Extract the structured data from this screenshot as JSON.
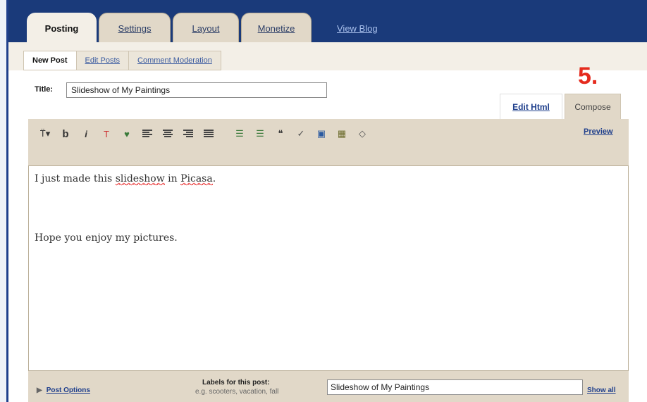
{
  "nav": {
    "tabs": [
      {
        "label": "Posting",
        "active": true
      },
      {
        "label": "Settings",
        "active": false
      },
      {
        "label": "Layout",
        "active": false
      },
      {
        "label": "Monetize",
        "active": false
      }
    ],
    "view_blog": "View Blog"
  },
  "subnav": {
    "tabs": [
      {
        "label": "New Post",
        "active": true
      },
      {
        "label": "Edit Posts",
        "active": false
      },
      {
        "label": "Comment Moderation",
        "active": false
      }
    ]
  },
  "post": {
    "title_label": "Title:",
    "title_value": "Slideshow of My Paintings"
  },
  "annotation": {
    "step": "5."
  },
  "mode_tabs": {
    "edit_html": "Edit Html",
    "compose": "Compose"
  },
  "toolbar": {
    "font_icon": "T̈▾",
    "bold": "b",
    "italic": "i",
    "text_color_icon": "T",
    "highlight_icon": "♥",
    "list_icon": "☰",
    "quote_icon": "❝",
    "spell_icon": "✓",
    "image_icon": "▣",
    "video_icon": "▦",
    "eraser_icon": "◇",
    "preview": "Preview"
  },
  "editor": {
    "line1_a": "I just made this ",
    "line1_b": "slideshow",
    "line1_c": " in ",
    "line1_d": "Picasa",
    "line1_e": ".",
    "line2": "Hope you enjoy my pictures."
  },
  "footer": {
    "post_options": "Post Options",
    "labels_title": "Labels for this post:",
    "labels_hint": "e.g. scooters, vacation, fall",
    "labels_value": "Slideshow of My Paintings",
    "show_all": "Show all"
  },
  "colors": {
    "header_blue": "#1a3a7a",
    "tab_beige": "#e1d8c8",
    "link_blue": "#1f3f8c",
    "annotation_red": "#e52b1e"
  }
}
